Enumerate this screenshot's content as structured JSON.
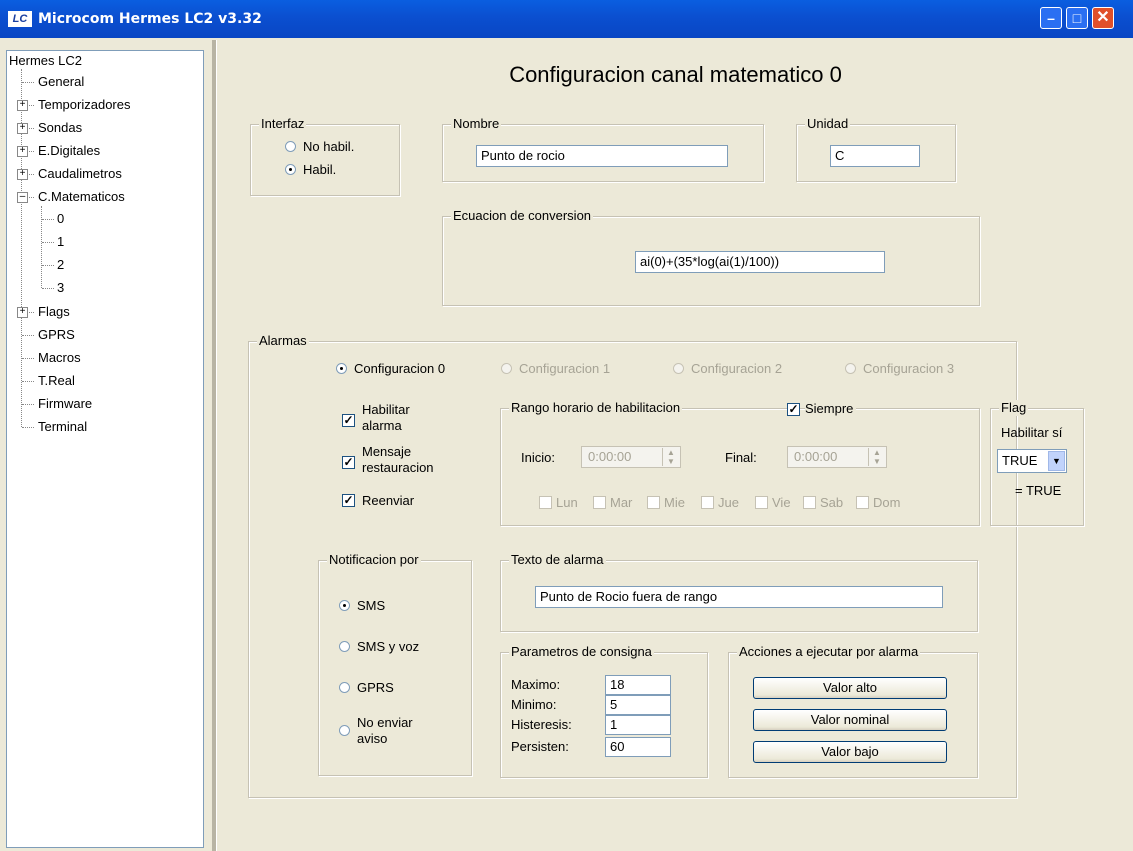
{
  "window": {
    "title": "Microcom Hermes LC2 v3.32",
    "logo": "LC"
  },
  "tree": {
    "root": "Hermes LC2",
    "items": [
      {
        "label": "General"
      },
      {
        "label": "Temporizadores"
      },
      {
        "label": "Sondas"
      },
      {
        "label": "E.Digitales"
      },
      {
        "label": "Caudalimetros"
      },
      {
        "label": "C.Matematicos"
      },
      {
        "label": "0"
      },
      {
        "label": "1"
      },
      {
        "label": "2"
      },
      {
        "label": "3"
      },
      {
        "label": "Flags"
      },
      {
        "label": "GPRS"
      },
      {
        "label": "Macros"
      },
      {
        "label": "T.Real"
      },
      {
        "label": "Firmware"
      },
      {
        "label": "Terminal"
      }
    ]
  },
  "main": {
    "title": "Configuracion canal matematico  0",
    "interfaz": {
      "label": "Interfaz",
      "options": [
        "No habil.",
        "Habil."
      ],
      "selected": "Habil."
    },
    "nombre": {
      "label": "Nombre",
      "value": "Punto de rocio"
    },
    "unidad": {
      "label": "Unidad",
      "value": "C"
    },
    "ecuacion": {
      "label": "Ecuacion de conversion",
      "value": "ai(0)+(35*log(ai(1)/100))"
    },
    "alarmas": {
      "label": "Alarmas",
      "configs": [
        "Configuracion 0",
        "Configuracion 1",
        "Configuracion 2",
        "Configuracion 3"
      ],
      "selected_config": "Configuracion 0",
      "checks": [
        {
          "line1": "Habilitar",
          "line2": "alarma",
          "checked": true
        },
        {
          "line1": "Mensaje",
          "line2": "restauracion",
          "checked": true
        },
        {
          "line1": "Reenviar",
          "line2": "",
          "checked": true
        }
      ],
      "rango": {
        "label": "Rango horario de habilitacion",
        "siempre": "Siempre",
        "siempre_checked": true,
        "inicio_label": "Inicio:",
        "inicio_value": "0:00:00",
        "final_label": "Final:",
        "final_value": "0:00:00",
        "days": [
          "Lun",
          "Mar",
          "Mie",
          "Jue",
          "Vie",
          "Sab",
          "Dom"
        ]
      },
      "flag": {
        "label": "Flag",
        "habilitar": "Habilitar sí",
        "value": "TRUE",
        "eq": "= TRUE"
      },
      "notificacion": {
        "label": "Notificacion por",
        "options": [
          {
            "line1": "SMS",
            "line2": ""
          },
          {
            "line1": "SMS y voz",
            "line2": ""
          },
          {
            "line1": "GPRS",
            "line2": ""
          },
          {
            "line1": "No enviar",
            "line2": "aviso"
          }
        ],
        "selected": "SMS"
      },
      "texto": {
        "label": "Texto de alarma",
        "value": "Punto de Rocio fuera de rango"
      },
      "consigna": {
        "label": "Parametros de consigna",
        "rows": [
          {
            "label": "Maximo:",
            "value": "18"
          },
          {
            "label": "Minimo:",
            "value": "5"
          },
          {
            "label": "Histeresis:",
            "value": "1"
          },
          {
            "label": "Persisten:",
            "value": "60"
          }
        ]
      },
      "acciones": {
        "label": "Acciones a ejecutar por alarma",
        "buttons": [
          "Valor alto",
          "Valor nominal",
          "Valor bajo"
        ]
      }
    }
  },
  "colors": {
    "titlebar": "#0b4fd0",
    "window_bg": "#ece9d8",
    "close": "#e0502a"
  }
}
